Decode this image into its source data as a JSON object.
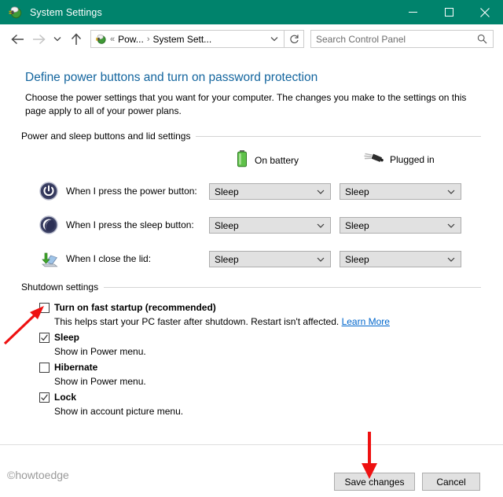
{
  "window": {
    "title": "System Settings",
    "icon": "power-options-icon",
    "accent_color": "#00836c",
    "controls": {
      "minimize": "minimize-icon",
      "maximize": "maximize-icon",
      "close": "close-icon"
    }
  },
  "navbar": {
    "back": "back-arrow-icon",
    "forward": "forward-arrow-icon",
    "recent": "chevron-down-icon",
    "up": "up-arrow-icon",
    "address": {
      "icon": "power-options-icon",
      "overflow": "«",
      "crumbs": [
        "Pow...",
        "System Sett..."
      ],
      "separator": "›",
      "dropdown": "chevron-down-icon"
    },
    "refresh": "refresh-icon",
    "search": {
      "placeholder": "Search Control Panel",
      "icon": "search-icon"
    }
  },
  "page": {
    "title": "Define power buttons and turn on password protection",
    "description": "Choose the power settings that you want for your computer. The changes you make to the settings on this page apply to all of your power plans."
  },
  "sections": {
    "power_buttons": {
      "header": "Power and sleep buttons and lid settings",
      "columns": [
        {
          "label": "On battery",
          "icon": "battery-icon"
        },
        {
          "label": "Plugged in",
          "icon": "power-plug-icon"
        }
      ],
      "rows": [
        {
          "icon": "power-button-icon",
          "label": "When I press the power button:",
          "on_battery": "Sleep",
          "plugged_in": "Sleep"
        },
        {
          "icon": "sleep-moon-icon",
          "label": "When I press the sleep button:",
          "on_battery": "Sleep",
          "plugged_in": "Sleep"
        },
        {
          "icon": "laptop-lid-icon",
          "label": "When I close the lid:",
          "on_battery": "Sleep",
          "plugged_in": "Sleep"
        }
      ]
    },
    "shutdown": {
      "header": "Shutdown settings",
      "items": [
        {
          "label": "Turn on fast startup (recommended)",
          "checked": false,
          "description": "This helps start your PC faster after shutdown. Restart isn't affected.",
          "link": "Learn More"
        },
        {
          "label": "Sleep",
          "checked": true,
          "description": "Show in Power menu.",
          "link": ""
        },
        {
          "label": "Hibernate",
          "checked": false,
          "description": "Show in Power menu.",
          "link": ""
        },
        {
          "label": "Lock",
          "checked": true,
          "description": "Show in account picture menu.",
          "link": ""
        }
      ]
    }
  },
  "footer": {
    "watermark": "©howtoedge",
    "save_label": "Save changes",
    "cancel_label": "Cancel"
  },
  "annotations": {
    "color": "#ee1111",
    "arrow_fast_startup": "red-arrow-up-right",
    "arrow_save_changes": "red-arrow-down"
  }
}
